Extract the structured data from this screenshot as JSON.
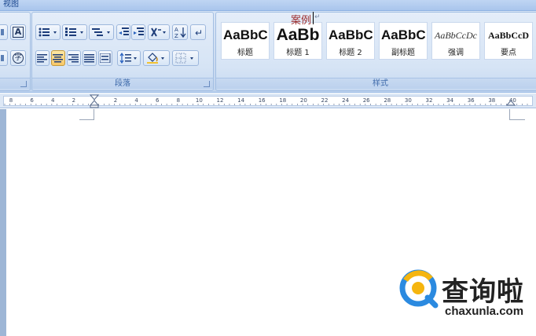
{
  "ribbon": {
    "tab_view": "视图",
    "paragraph_group_label": "段落",
    "styles_group_label": "样式",
    "styles": [
      {
        "sample": "AaBbC",
        "name": "标题"
      },
      {
        "sample": "AaBb",
        "name": "标题 1"
      },
      {
        "sample": "AaBbC",
        "name": "标题 2"
      },
      {
        "sample": "AaBbC",
        "name": "副标题"
      },
      {
        "sample": "AaBbCcDc",
        "name": "强调"
      },
      {
        "sample": "AaBbCcD",
        "name": "要点"
      }
    ],
    "font_buttons": {
      "char_border": "A",
      "enclose_char": "字"
    }
  },
  "ruler": {
    "numbers": [
      "8",
      "6",
      "4",
      "2",
      "2",
      "4",
      "6",
      "8",
      "10",
      "12",
      "14",
      "16",
      "18",
      "20",
      "22",
      "24",
      "26",
      "28",
      "30",
      "32",
      "34",
      "36",
      "38",
      "40"
    ]
  },
  "document": {
    "text": "案例",
    "pilcrow": "↵"
  },
  "watermark": {
    "brand": "查询啦",
    "url": "chaxunla.com"
  }
}
